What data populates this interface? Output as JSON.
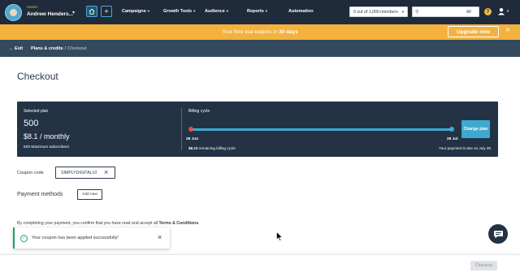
{
  "topnav": {
    "owner_role": "Owner",
    "owner_name": "Andrew Henders...",
    "items": [
      {
        "label": "Campaigns"
      },
      {
        "label": "Growth Tools"
      },
      {
        "label": "Audience"
      },
      {
        "label": "Reports"
      },
      {
        "label": "Automation"
      }
    ],
    "members_select": "0 out of 1,000 members",
    "search_value": "",
    "search_scope": "All"
  },
  "banner": {
    "text_prefix": "Your free trial expires in ",
    "text_days": "30 days",
    "upgrade_label": "Upgrade now"
  },
  "breadcrumb": {
    "exit_label": "Exit",
    "crumb1": "Plans & credits",
    "separator": "/",
    "crumb2": "Checkout"
  },
  "page": {
    "title": "Checkout"
  },
  "plan": {
    "selected_label": "Selected plan",
    "amount": "500",
    "price": "$8.1 / monthly",
    "subscribers": "500 Maximum subscribers",
    "cycle_label": "Billing cycle",
    "cycle_start": "28 Jun",
    "cycle_end": "28 Jul",
    "remaining_amount": "$8.10",
    "remaining_suffix": " remaining billing cycle",
    "due_text": "Your payment is due on July 28",
    "change_plan_label": "Change plan"
  },
  "coupon": {
    "label": "Coupon code",
    "code": "SIMPLYDIGITAL10"
  },
  "payment": {
    "label": "Payment methods",
    "add_new_label": "Add new"
  },
  "consent": {
    "text": "By completing your payment, you confirm that you have read and accept all ",
    "link": "Terms & Conditions"
  },
  "toast": {
    "message": "Your coupon has been applied successfully!"
  },
  "footer": {
    "checkout_label": "Checkout"
  },
  "colors": {
    "nav_bg": "#1f2b3a",
    "banner_bg": "#f3b23e",
    "crumb_bg": "#33495e",
    "panel_bg": "#233345",
    "accent": "#3fa9cf",
    "success": "#19a65a",
    "cycle_start_dot": "#e0503f"
  }
}
